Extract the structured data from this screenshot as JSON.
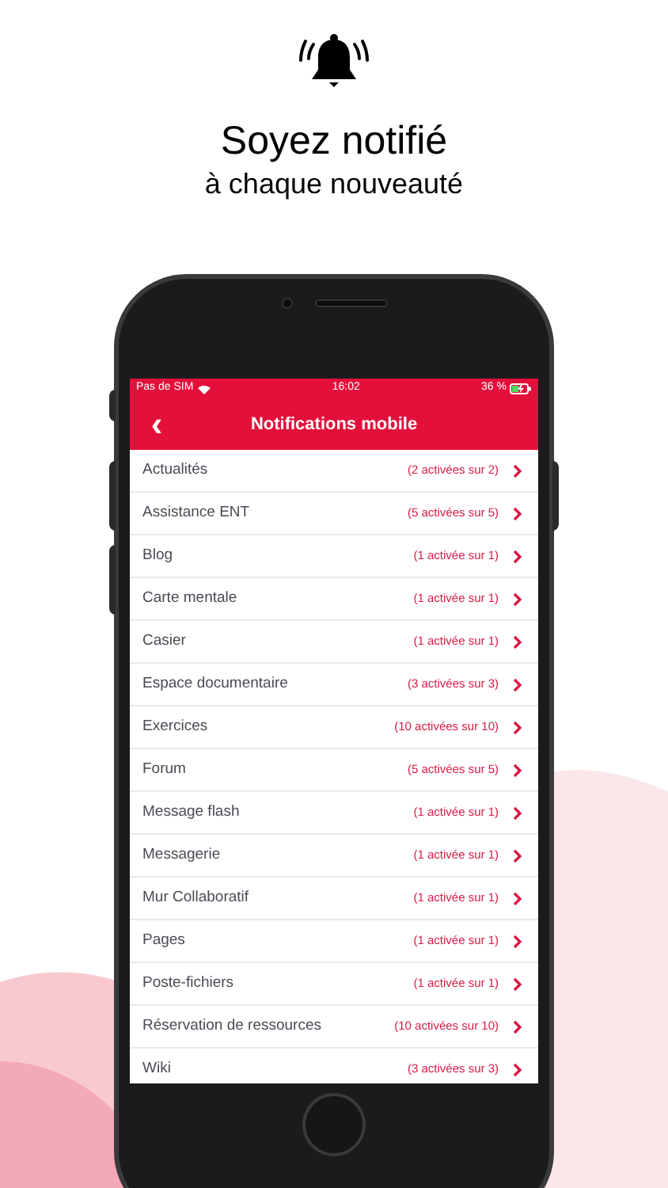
{
  "headline": {
    "title": "Soyez notifié",
    "subtitle": "à chaque nouveauté"
  },
  "status_bar": {
    "carrier": "Pas de SIM",
    "time": "16:02",
    "battery": "36 %"
  },
  "nav_bar": {
    "back": "‹",
    "title": "Notifications mobile"
  },
  "items": [
    {
      "label": "Actualités",
      "count": "(2 activées sur 2)"
    },
    {
      "label": "Assistance ENT",
      "count": "(5 activées sur 5)"
    },
    {
      "label": "Blog",
      "count": "(1 activée sur 1)"
    },
    {
      "label": "Carte mentale",
      "count": "(1 activée sur 1)"
    },
    {
      "label": "Casier",
      "count": "(1 activée sur 1)"
    },
    {
      "label": "Espace documentaire",
      "count": "(3 activées sur 3)"
    },
    {
      "label": "Exercices",
      "count": "(10 activées sur 10)"
    },
    {
      "label": "Forum",
      "count": "(5 activées sur 5)"
    },
    {
      "label": "Message flash",
      "count": "(1 activée sur 1)"
    },
    {
      "label": "Messagerie",
      "count": "(1 activée sur 1)"
    },
    {
      "label": "Mur Collaboratif",
      "count": "(1 activée sur 1)"
    },
    {
      "label": "Pages",
      "count": "(1 activée sur 1)"
    },
    {
      "label": "Poste-fichiers",
      "count": "(1 activée sur 1)"
    },
    {
      "label": "Réservation de ressources",
      "count": "(10 activées sur 10)"
    },
    {
      "label": "Wiki",
      "count": "(3 activées sur 3)"
    }
  ]
}
